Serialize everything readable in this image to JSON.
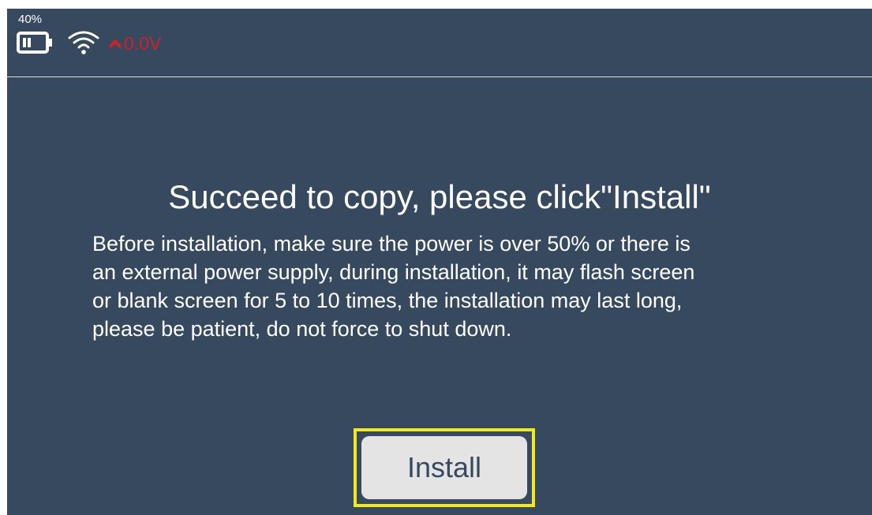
{
  "status_bar": {
    "battery_percent": "40%",
    "voltage": "0.0V",
    "colors": {
      "voltage_warning": "#d0202a",
      "icon": "#ffffff"
    }
  },
  "dialog": {
    "title": "Succeed to copy, please click\"Install\"",
    "message_lines": [
      "Before installation, make sure the power is over 50% or there is",
      "an external power supply, during installation, it may flash screen",
      "or blank screen for 5 to 10 times, the installation may last long,",
      "please be patient, do not force to shut down."
    ],
    "install_button": "Install"
  },
  "colors": {
    "background": "#36495e",
    "highlight_border": "#f3e81c",
    "button_background": "#e4e4e4",
    "button_text": "#36495e"
  }
}
